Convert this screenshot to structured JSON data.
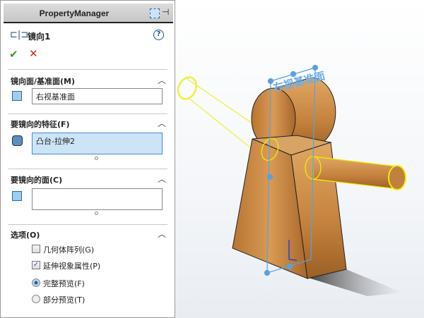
{
  "panel": {
    "title": "PropertyManager",
    "feature_name": "镜向1",
    "icons": [
      "auto-size-icon",
      "pin-icon",
      "help-icon",
      "ok-icon",
      "cancel-icon"
    ]
  },
  "sections": {
    "mirror_plane": {
      "title": "镜向面/基准面(M)",
      "value": "右视基准面"
    },
    "features": {
      "title": "要镜向的特征(F)",
      "value": "凸台-拉伸2"
    },
    "faces": {
      "title": "要镜向的面(C)",
      "value": ""
    },
    "options": {
      "title": "选项(O)",
      "geometry_pattern": {
        "label": "几何体阵列(G)",
        "checked": false
      },
      "propagate_visual": {
        "label": "延伸视象属性(P)",
        "checked": true
      },
      "full_preview": {
        "label": "完整预览(F)",
        "selected": true
      },
      "partial_preview": {
        "label": "部分预览(T)",
        "selected": false
      }
    }
  },
  "viewport": {
    "plane_label": "右视基准面",
    "colors": {
      "wood": "#c98a45",
      "plane": "#5aa0e0",
      "preview": "#ffff00"
    }
  }
}
